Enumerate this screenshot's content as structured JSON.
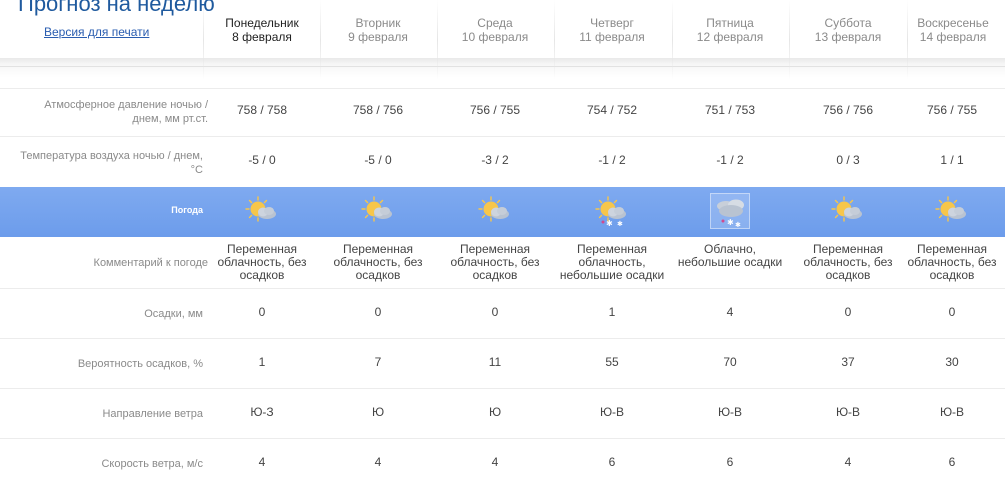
{
  "header": {
    "title": "Прогноз на неделю",
    "print_link": "Версия для печати"
  },
  "days": [
    {
      "name": "Понедельник",
      "date": "8 февраля",
      "icon": "partly-cloudy-night-icon"
    },
    {
      "name": "Вторник",
      "date": "9 февраля",
      "icon": "partly-cloudy-night-icon"
    },
    {
      "name": "Среда",
      "date": "10 февраля",
      "icon": "partly-cloudy-night-icon"
    },
    {
      "name": "Четверг",
      "date": "11 февраля",
      "icon": "partly-cloudy-night-light-snow-icon"
    },
    {
      "name": "Пятница",
      "date": "12 февраля",
      "icon": "cloudy-light-snow-icon"
    },
    {
      "name": "Суббота",
      "date": "13 февраля",
      "icon": "partly-cloudy-night-icon"
    },
    {
      "name": "Воскресенье",
      "date": "14 февраля",
      "icon": "partly-cloudy-night-icon"
    }
  ],
  "labels": {
    "pressure_line1": "Атмосферное давление ночью  /",
    "pressure_line2": "днем, мм рт.ст.",
    "temp_line1": "Температура воздуха ночью  /  днем,",
    "temp_line2": "°C",
    "weather": "Погода",
    "comment": "Комментарий к погоде",
    "precip": "Осадки, мм",
    "prob": "Вероятность осадков, %",
    "wind_dir": "Направление ветра",
    "wind_speed": "Скорость ветра, м/с"
  },
  "rows": {
    "pressure": [
      "758 / 758",
      "758 / 756",
      "756 / 755",
      "754 / 752",
      "751 / 753",
      "756 / 756",
      "756 / 755"
    ],
    "temp": [
      "-5 / 0",
      "-5 / 0",
      "-3 / 2",
      "-1 / 2",
      "-1 / 2",
      "0 / 3",
      "1 / 1"
    ],
    "comment": [
      [
        "Переменная",
        "облачность, без",
        "осадков"
      ],
      [
        "Переменная",
        "облачность, без",
        "осадков"
      ],
      [
        "Переменная",
        "облачность, без",
        "осадков"
      ],
      [
        "Переменная",
        "облачность,",
        "небольшие осадки"
      ],
      [
        "Облачно,",
        "небольшие осадки",
        ""
      ],
      [
        "Переменная",
        "облачность, без",
        "осадков"
      ],
      [
        "Переменная",
        "облачность, без",
        "осадков"
      ]
    ],
    "precip": [
      "0",
      "0",
      "0",
      "1",
      "4",
      "0",
      "0"
    ],
    "prob": [
      "1",
      "7",
      "11",
      "55",
      "70",
      "37",
      "30"
    ],
    "wind_dir": [
      "Ю-З",
      "Ю",
      "Ю",
      "Ю-В",
      "Ю-В",
      "Ю-В",
      "Ю-В"
    ],
    "wind_speed": [
      "4",
      "4",
      "4",
      "6",
      "6",
      "4",
      "6"
    ]
  },
  "colors": {
    "band": "#6f9fec",
    "sun": "#f7c64a",
    "cloud": "#b9c3d1",
    "title": "#1f5a9e"
  }
}
